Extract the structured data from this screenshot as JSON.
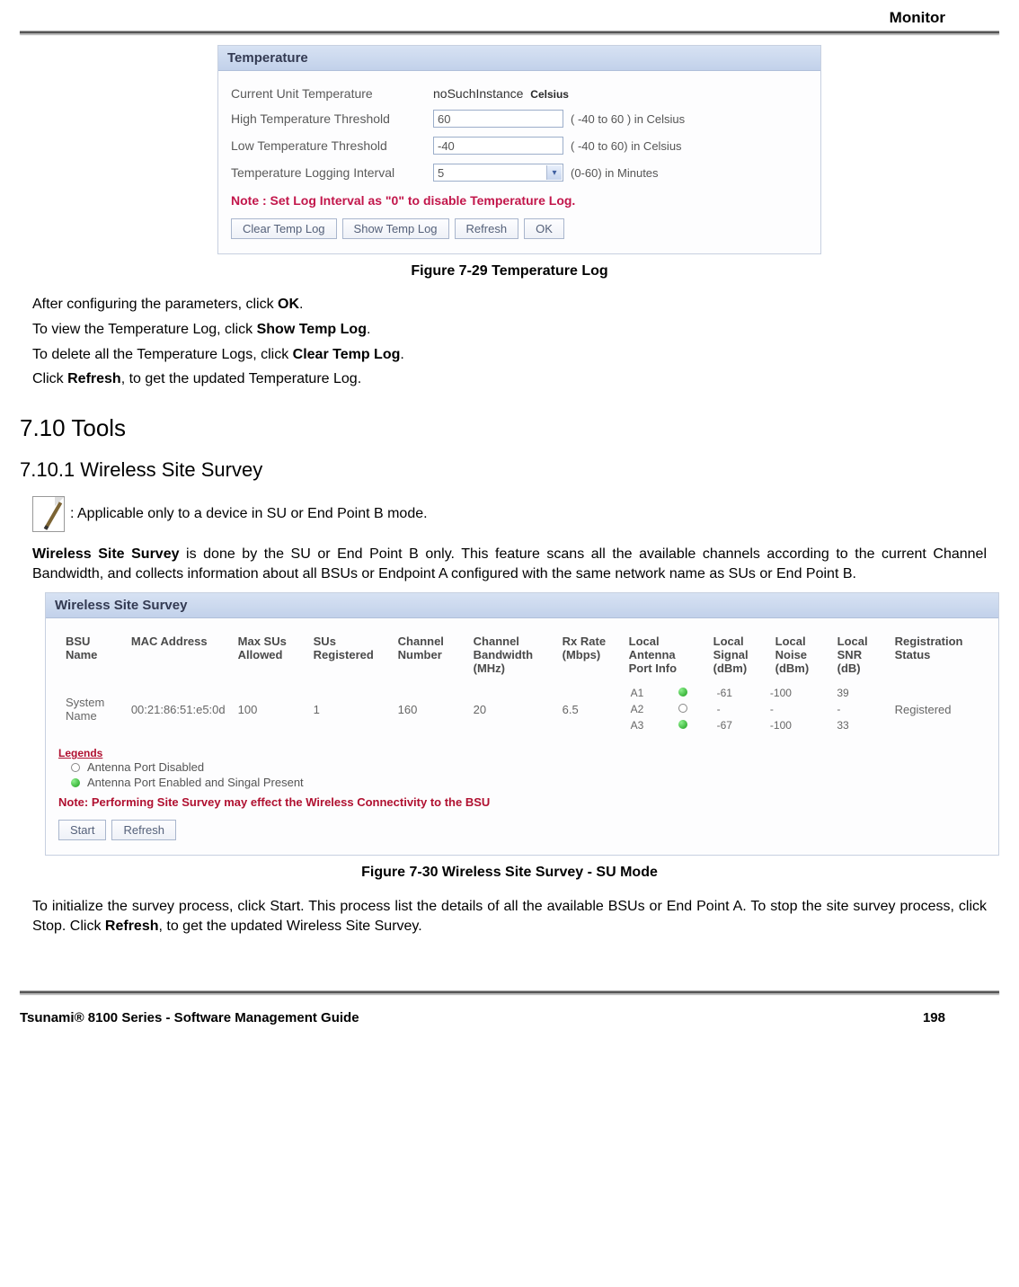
{
  "header": {
    "title": "Monitor"
  },
  "tempPanel": {
    "title": "Temperature",
    "rows": {
      "current": {
        "label": "Current Unit Temperature",
        "value": "noSuchInstance",
        "unit": "Celsius"
      },
      "high": {
        "label": "High Temperature Threshold",
        "value": "60",
        "hint": "( -40 to 60 ) in Celsius"
      },
      "low": {
        "label": "Low Temperature Threshold",
        "value": "-40",
        "hint": "( -40 to 60) in Celsius"
      },
      "interval": {
        "label": "Temperature Logging Interval",
        "value": "5",
        "hint": "(0-60) in Minutes"
      }
    },
    "note": "Note : Set Log Interval as \"0\" to disable Temperature Log.",
    "buttons": {
      "clear": "Clear Temp Log",
      "show": "Show Temp Log",
      "refresh": "Refresh",
      "ok": "OK"
    }
  },
  "fig1": "Figure 7-29 Temperature Log",
  "para1": {
    "pre": "After configuring the parameters, click ",
    "bold": "OK",
    "post": "."
  },
  "para2": {
    "pre": "To view the Temperature Log, click ",
    "bold": "Show Temp Log",
    "post": "."
  },
  "para3": {
    "pre": "To delete all the Temperature Logs, click ",
    "bold": "Clear Temp Log",
    "post": "."
  },
  "para4": {
    "pre": "Click ",
    "bold": "Refresh",
    "post": ", to get the updated Temperature Log."
  },
  "h2": "7.10 Tools",
  "h3": "7.10.1 Wireless Site Survey",
  "noteIcon": ": Applicable only to a device in SU or End Point B mode.",
  "wssPara": {
    "bold": "Wireless Site Survey",
    "rest": " is done by the SU or End Point B only. This feature scans all the available channels according to the current Channel Bandwidth, and collects information about all BSUs or Endpoint A configured with the same network name as SUs or End Point B."
  },
  "surveyPanel": {
    "title": "Wireless Site Survey",
    "columns": {
      "bsu": "BSU Name",
      "mac": "MAC Address",
      "maxsu": "Max SUs Allowed",
      "sureg": "SUs Registered",
      "chnum": "Channel Number",
      "chbw": "Channel Bandwidth (MHz)",
      "rxrate": "Rx Rate (Mbps)",
      "antinfo": "Local Antenna Port Info",
      "sig": "Local Signal (dBm)",
      "noise": "Local Noise (dBm)",
      "snr": "Local SNR (dB)",
      "regstat": "Registration Status"
    },
    "row": {
      "bsu": "System Name",
      "mac": "00:21:86:51:e5:0d",
      "maxsu": "100",
      "sureg": "1",
      "chnum": "160",
      "chbw": "20",
      "rxrate": "6.5",
      "ant": [
        {
          "name": "A1",
          "state": "green",
          "sig": "-61",
          "noise": "-100",
          "snr": "39"
        },
        {
          "name": "A2",
          "state": "empty",
          "sig": "-",
          "noise": "-",
          "snr": "-"
        },
        {
          "name": "A3",
          "state": "green",
          "sig": "-67",
          "noise": "-100",
          "snr": "33"
        }
      ],
      "regstat": "Registered"
    },
    "legends": {
      "title": "Legends",
      "disabled": "Antenna Port Disabled",
      "enabled": "Antenna Port Enabled and Singal Present"
    },
    "note": "Note: Performing Site Survey may effect the Wireless Connectivity to the BSU",
    "buttons": {
      "start": "Start",
      "refresh": "Refresh"
    }
  },
  "fig2": "Figure 7-30 Wireless Site Survey - SU Mode",
  "lastPara": {
    "pre": "To initialize the survey process, click Start. This process list the details of all the available BSUs or End Point A. To stop the site survey process, click Stop. Click ",
    "bold": "Refresh",
    "post": ", to get the updated Wireless Site Survey."
  },
  "footer": {
    "left": "Tsunami® 8100 Series - Software Management Guide",
    "right": "198"
  }
}
